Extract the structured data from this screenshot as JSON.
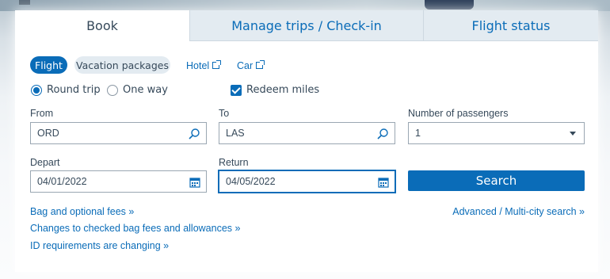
{
  "tabs": [
    {
      "label": "Book"
    },
    {
      "label": "Manage trips / Check-in"
    },
    {
      "label": "Flight status"
    }
  ],
  "product_pills": {
    "flight": "Flight",
    "vacation": "Vacation packages"
  },
  "product_links": {
    "hotel": "Hotel",
    "car": "Car"
  },
  "trip_type": {
    "round_trip": "Round trip",
    "one_way": "One way",
    "selected": "Round trip"
  },
  "redeem_miles": {
    "label": "Redeem miles",
    "checked": true
  },
  "from": {
    "label": "From",
    "value": "ORD"
  },
  "to": {
    "label": "To",
    "value": "LAS"
  },
  "passengers": {
    "label": "Number of passengers",
    "value": "1"
  },
  "depart": {
    "label": "Depart",
    "value": "04/01/2022"
  },
  "return": {
    "label": "Return",
    "value": "04/05/2022"
  },
  "search_button": "Search",
  "links": {
    "bag_fees": "Bag and optional fees »",
    "changes": "Changes to checked bag fees and allowances »",
    "id_req": "ID requirements are changing »",
    "advanced": "Advanced / Multi-city search »"
  },
  "icons": {
    "search": "magnifier-icon",
    "calendar": "calendar-icon",
    "dropdown": "chevron-down-icon",
    "external": "external-link-icon"
  },
  "colors": {
    "accent": "#0a6cb8",
    "text": "#36495a",
    "inactive_tab": "#e3ebf1"
  }
}
